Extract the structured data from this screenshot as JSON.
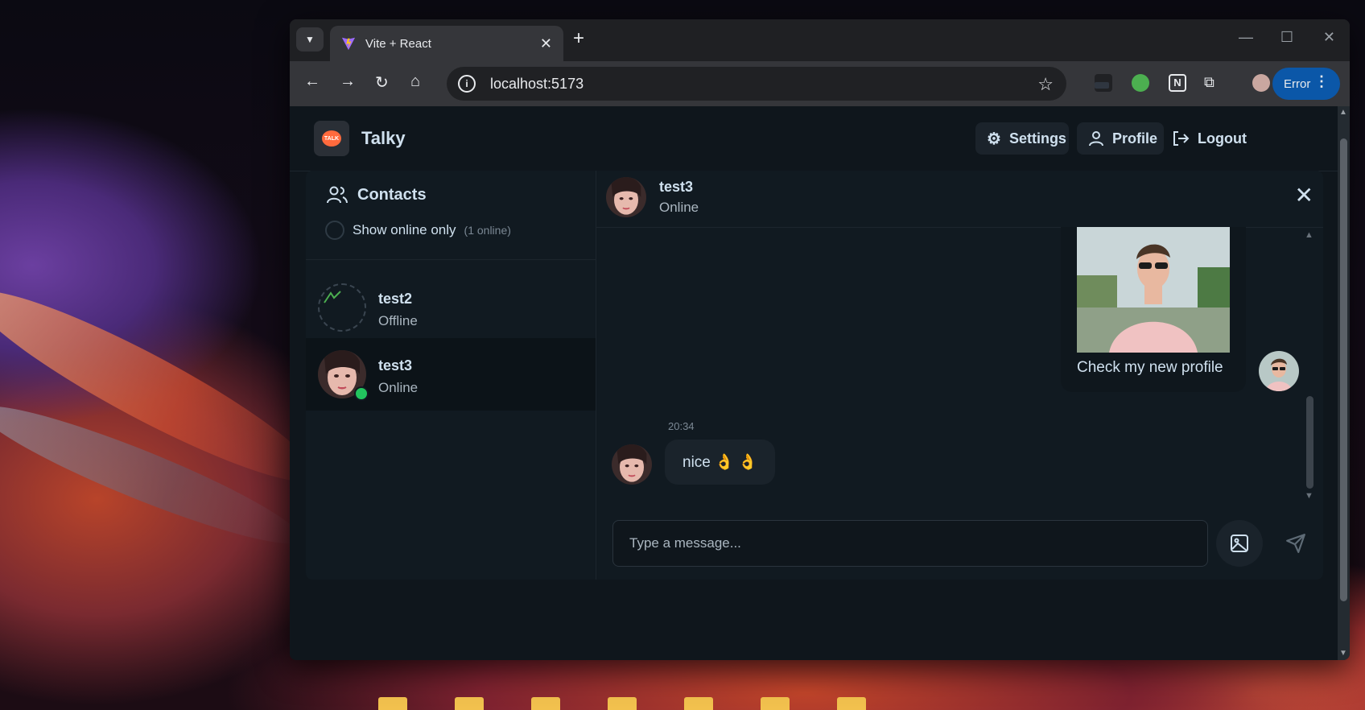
{
  "browser": {
    "tab_title": "Vite + React",
    "url": "localhost:5173",
    "error_label": "Error"
  },
  "app": {
    "brand": "Talky",
    "logo_text": "TALK",
    "nav": {
      "settings": "Settings",
      "profile": "Profile",
      "logout": "Logout"
    }
  },
  "sidebar": {
    "title": "Contacts",
    "filter_label": "Show online only",
    "online_count": "(1 online)",
    "contacts": [
      {
        "name": "test2",
        "status": "Offline"
      },
      {
        "name": "test3",
        "status": "Online"
      }
    ]
  },
  "chat": {
    "header": {
      "name": "test3",
      "status": "Online"
    },
    "messages": [
      {
        "direction": "out",
        "text": "Check my new profile",
        "has_image": true
      },
      {
        "direction": "in",
        "time": "20:34",
        "text": "nice 👌 👌"
      }
    ],
    "input_placeholder": "Type a message..."
  },
  "colors": {
    "accent_online": "#22c55e",
    "brand_logo": "#ff6a3d",
    "error_pill": "#0b57a8"
  }
}
